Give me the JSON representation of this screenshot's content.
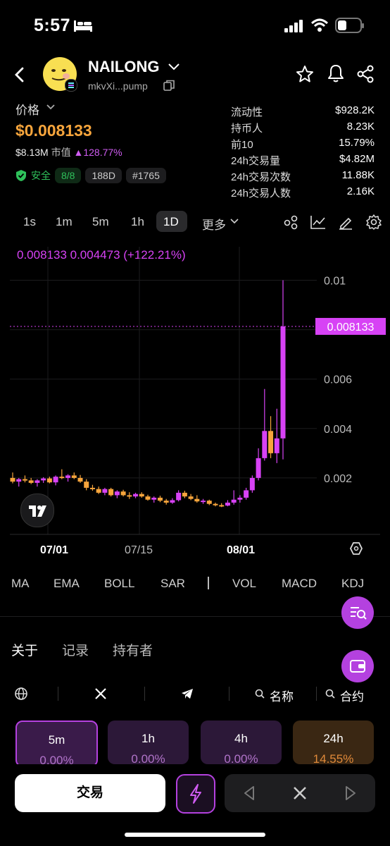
{
  "status_bar": {
    "time": "5:57"
  },
  "header": {
    "token_name": "NAILONG",
    "address": "mkvXi...pump"
  },
  "price": {
    "label": "价格",
    "value": "$0.008133",
    "market_cap": "$8.13M",
    "market_cap_label": "市值",
    "change": "128.77%",
    "accent_color": "#f7a53c"
  },
  "badges": {
    "safety_label": "安全",
    "safety_score": "8/8",
    "age": "188D",
    "rank": "#1765"
  },
  "stats": [
    {
      "label": "流动性",
      "value": "$928.2K"
    },
    {
      "label": "持币人",
      "value": "8.23K"
    },
    {
      "label": "前10",
      "value": "15.79%"
    },
    {
      "label": "24h交易量",
      "value": "$4.82M"
    },
    {
      "label": "24h交易次数",
      "value": "11.88K"
    },
    {
      "label": "24h交易人数",
      "value": "2.16K"
    }
  ],
  "timeframes": [
    "1s",
    "1m",
    "5m",
    "1h",
    "1D",
    "更多"
  ],
  "selected_timeframe": "1D",
  "chart_header": "0.008133  0.004473 (+122.21%)",
  "chart_data": {
    "type": "candlestick",
    "current_price_label": "0.008133",
    "y_ticks": [
      "0.01",
      "0.008",
      "0.006",
      "0.004",
      "0.002"
    ],
    "y_tick_values": [
      0.01,
      0.008,
      0.006,
      0.004,
      0.002
    ],
    "ylim": [
      0.0,
      0.0105
    ],
    "x_ticks": [
      "07/01",
      "07/15",
      "08/01"
    ],
    "up_color": "#d742f5",
    "down_color": "#f7a53c",
    "candles": [
      {
        "o": 0.002,
        "h": 0.00222,
        "l": 0.00178,
        "c": 0.00185
      },
      {
        "o": 0.00185,
        "h": 0.002,
        "l": 0.00165,
        "c": 0.00195
      },
      {
        "o": 0.00195,
        "h": 0.0021,
        "l": 0.00182,
        "c": 0.0019
      },
      {
        "o": 0.0019,
        "h": 0.002,
        "l": 0.00175,
        "c": 0.0018
      },
      {
        "o": 0.0018,
        "h": 0.00195,
        "l": 0.00165,
        "c": 0.0019
      },
      {
        "o": 0.0019,
        "h": 0.00203,
        "l": 0.0018,
        "c": 0.00198
      },
      {
        "o": 0.00198,
        "h": 0.00205,
        "l": 0.00178,
        "c": 0.00182
      },
      {
        "o": 0.00182,
        "h": 0.0021,
        "l": 0.0017,
        "c": 0.00205
      },
      {
        "o": 0.00205,
        "h": 0.00235,
        "l": 0.00195,
        "c": 0.002
      },
      {
        "o": 0.002,
        "h": 0.00215,
        "l": 0.00185,
        "c": 0.0021
      },
      {
        "o": 0.0021,
        "h": 0.00222,
        "l": 0.00195,
        "c": 0.002
      },
      {
        "o": 0.002,
        "h": 0.00212,
        "l": 0.0018,
        "c": 0.00185
      },
      {
        "o": 0.00185,
        "h": 0.00195,
        "l": 0.0015,
        "c": 0.0016
      },
      {
        "o": 0.0016,
        "h": 0.00172,
        "l": 0.00148,
        "c": 0.00155
      },
      {
        "o": 0.00155,
        "h": 0.00165,
        "l": 0.00135,
        "c": 0.0014
      },
      {
        "o": 0.0014,
        "h": 0.0016,
        "l": 0.0013,
        "c": 0.00155
      },
      {
        "o": 0.00155,
        "h": 0.0016,
        "l": 0.00125,
        "c": 0.0013
      },
      {
        "o": 0.0013,
        "h": 0.0015,
        "l": 0.00118,
        "c": 0.00145
      },
      {
        "o": 0.00145,
        "h": 0.00152,
        "l": 0.00125,
        "c": 0.0013
      },
      {
        "o": 0.0013,
        "h": 0.00142,
        "l": 0.00115,
        "c": 0.00125
      },
      {
        "o": 0.00125,
        "h": 0.0014,
        "l": 0.00118,
        "c": 0.00135
      },
      {
        "o": 0.00135,
        "h": 0.00142,
        "l": 0.0012,
        "c": 0.00125
      },
      {
        "o": 0.00125,
        "h": 0.00132,
        "l": 0.00108,
        "c": 0.00112
      },
      {
        "o": 0.00112,
        "h": 0.00125,
        "l": 0.001,
        "c": 0.0012
      },
      {
        "o": 0.0012,
        "h": 0.00128,
        "l": 0.00102,
        "c": 0.00108
      },
      {
        "o": 0.00108,
        "h": 0.00115,
        "l": 0.00092,
        "c": 0.001
      },
      {
        "o": 0.001,
        "h": 0.00118,
        "l": 0.00095,
        "c": 0.0011
      },
      {
        "o": 0.0011,
        "h": 0.0015,
        "l": 0.00105,
        "c": 0.0014
      },
      {
        "o": 0.0014,
        "h": 0.00148,
        "l": 0.00118,
        "c": 0.00125
      },
      {
        "o": 0.00125,
        "h": 0.00135,
        "l": 0.0011,
        "c": 0.00115
      },
      {
        "o": 0.00115,
        "h": 0.0013,
        "l": 0.001,
        "c": 0.00105
      },
      {
        "o": 0.00105,
        "h": 0.00115,
        "l": 0.00095,
        "c": 0.00108
      },
      {
        "o": 0.00108,
        "h": 0.00112,
        "l": 0.0009,
        "c": 0.00095
      },
      {
        "o": 0.00095,
        "h": 0.001,
        "l": 0.00085,
        "c": 0.0009
      },
      {
        "o": 0.0009,
        "h": 0.00098,
        "l": 0.00082,
        "c": 0.00088
      },
      {
        "o": 0.00088,
        "h": 0.0011,
        "l": 0.00085,
        "c": 0.001
      },
      {
        "o": 0.001,
        "h": 0.0015,
        "l": 0.00092,
        "c": 0.00112
      },
      {
        "o": 0.00112,
        "h": 0.0013,
        "l": 0.001,
        "c": 0.0012
      },
      {
        "o": 0.0012,
        "h": 0.0016,
        "l": 0.00112,
        "c": 0.0015
      },
      {
        "o": 0.0015,
        "h": 0.0021,
        "l": 0.0014,
        "c": 0.002
      },
      {
        "o": 0.002,
        "h": 0.0032,
        "l": 0.0019,
        "c": 0.0028
      },
      {
        "o": 0.0028,
        "h": 0.0056,
        "l": 0.0027,
        "c": 0.0039
      },
      {
        "o": 0.0039,
        "h": 0.0045,
        "l": 0.0028,
        "c": 0.003
      },
      {
        "o": 0.003,
        "h": 0.0048,
        "l": 0.0026,
        "c": 0.0036
      },
      {
        "o": 0.0036,
        "h": 0.01,
        "l": 0.00275,
        "c": 0.00813
      }
    ]
  },
  "indicators": [
    "MA",
    "EMA",
    "BOLL",
    "SAR",
    "VOL",
    "MACD",
    "KDJ"
  ],
  "info_tabs": [
    "关于",
    "记录",
    "持有者"
  ],
  "filters": {
    "name": "名称",
    "contract": "合约"
  },
  "period_cards": [
    {
      "label": "5m",
      "change": "0.00%"
    },
    {
      "label": "1h",
      "change": "0.00%"
    },
    {
      "label": "4h",
      "change": "0.00%"
    },
    {
      "label": "24h",
      "change": "14.55%"
    }
  ],
  "bottom_bar": {
    "trade_label": "交易"
  }
}
